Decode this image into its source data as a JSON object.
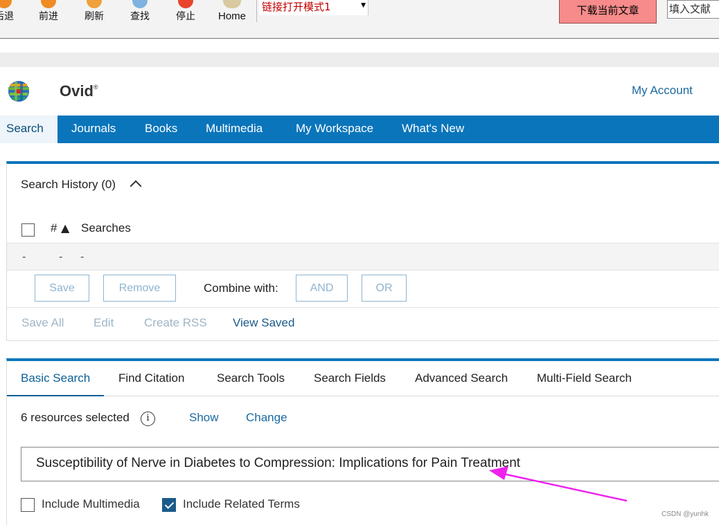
{
  "browser": {
    "buttons": {
      "back": "后退",
      "forward": "前进",
      "refresh": "刷新",
      "find": "查找",
      "stop": "停止",
      "home": "Home"
    },
    "mode_select": "链接打开模式1",
    "download_button": "下载当前文章",
    "fill_input": "填入文献"
  },
  "header": {
    "brand": "Ovid",
    "brand_mark": "®",
    "account_link": "My Account"
  },
  "nav": {
    "items": [
      "Search",
      "Journals",
      "Books",
      "Multimedia",
      "My Workspace",
      "What's New"
    ]
  },
  "history": {
    "title": "Search History (0)",
    "col_hash": "#",
    "col_sort_icon": "▲",
    "col_searches": "Searches",
    "row": [
      "-",
      "-",
      "-"
    ],
    "buttons": {
      "save": "Save",
      "remove": "Remove",
      "combine_label": "Combine with:",
      "and": "AND",
      "or": "OR"
    },
    "links": {
      "save_all": "Save All",
      "edit": "Edit",
      "create_rss": "Create RSS",
      "view_saved": "View Saved"
    }
  },
  "search": {
    "tabs": [
      "Basic Search",
      "Find Citation",
      "Search Tools",
      "Search Fields",
      "Advanced Search",
      "Multi-Field Search"
    ],
    "resources_text": "6 resources selected",
    "info_glyph": "i",
    "show_link": "Show",
    "change_link": "Change",
    "query": "Susceptibility of Nerve in Diabetes to  Compression: Implications for Pain Treatment",
    "include_multimedia": {
      "label": "Include Multimedia",
      "checked": false
    },
    "include_related": {
      "label": "Include Related Terms",
      "checked": true
    }
  },
  "annotation": {
    "color": "#ee22ee"
  },
  "watermark": "CSDN @yunhk"
}
